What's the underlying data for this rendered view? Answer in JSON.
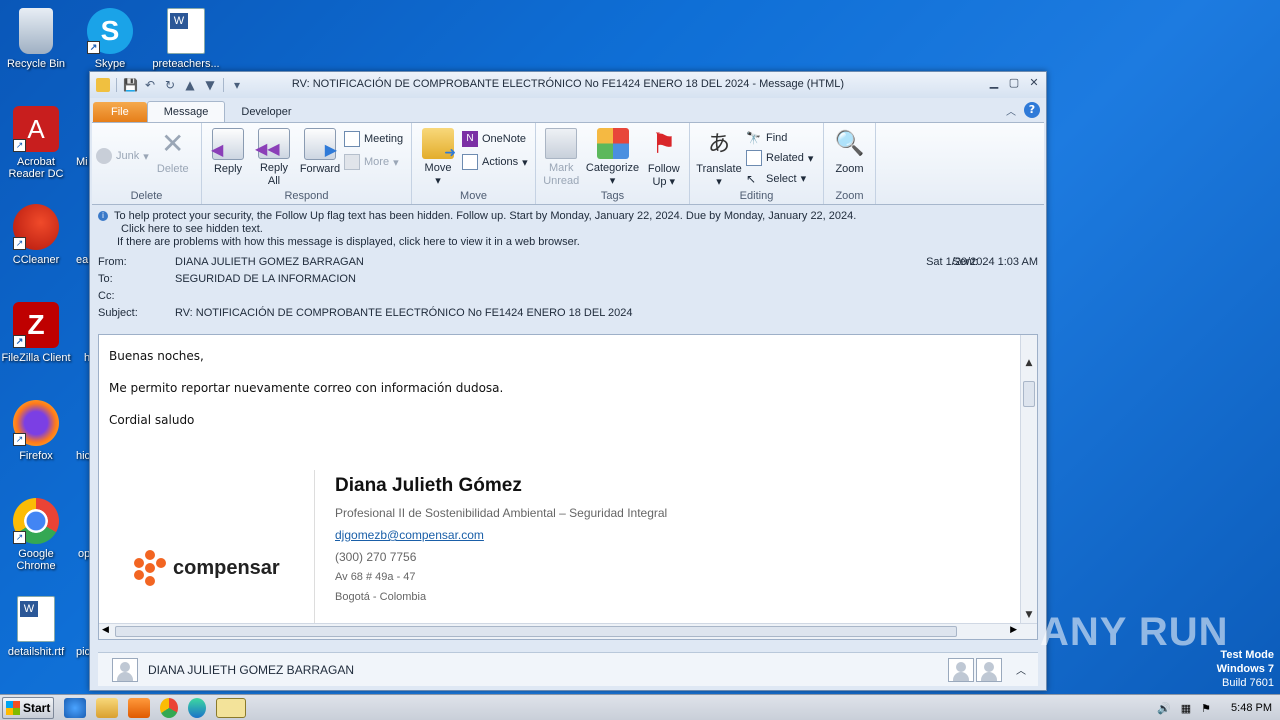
{
  "desktop": {
    "icons": [
      {
        "label": "Recycle Bin"
      },
      {
        "label": "Skype"
      },
      {
        "label": "preteachers..."
      },
      {
        "label": "Acrobat Reader DC"
      },
      {
        "label": "CCleaner"
      },
      {
        "label": "FileZilla Client"
      },
      {
        "label": "Firefox"
      },
      {
        "label": "Google Chrome"
      },
      {
        "label": "detailshit.rtf"
      }
    ],
    "partial_labels": [
      "Mi",
      "ea",
      "h",
      "hic",
      "op",
      "pic"
    ]
  },
  "window": {
    "title": "RV: NOTIFICACIÓN DE COMPROBANTE ELECTRÓNICO No FE1424 ENERO 18 DEL 2024 -  Message (HTML)",
    "tabs": [
      "File",
      "Message",
      "Developer"
    ],
    "active_tab": "Message"
  },
  "ribbon": {
    "delete": {
      "label": "Delete",
      "junk": "Junk",
      "delete_btn": "Delete"
    },
    "respond": {
      "label": "Respond",
      "reply": "Reply",
      "reply_all_1": "Reply",
      "reply_all_2": "All",
      "forward": "Forward",
      "meeting": "Meeting",
      "more": "More"
    },
    "move": {
      "label": "Move",
      "move_btn": "Move",
      "onenote": "OneNote",
      "actions": "Actions"
    },
    "tags": {
      "label": "Tags",
      "mark_unread_1": "Mark",
      "mark_unread_2": "Unread",
      "categorize": "Categorize",
      "follow_up_1": "Follow",
      "follow_up_2": "Up"
    },
    "editing": {
      "label": "Editing",
      "translate": "Translate",
      "find": "Find",
      "related": "Related",
      "select": "Select"
    },
    "zoom": {
      "label": "Zoom",
      "zoom_btn": "Zoom"
    }
  },
  "infobar": {
    "line1": "To help protect your security, the Follow Up flag text has been hidden. Follow up.  Start by Monday, January 22, 2024.  Due by Monday, January 22, 2024.",
    "line2": "Click here to see hidden text.",
    "line3": "If there are problems with how this message is displayed, click here to view it in a web browser."
  },
  "headers": {
    "from_label": "From:",
    "from": "DIANA JULIETH GOMEZ BARRAGAN",
    "sent_label": "Sent:",
    "sent": "Sat 1/20/2024 1:03 AM",
    "to_label": "To:",
    "to": "SEGURIDAD DE LA INFORMACION",
    "cc_label": "Cc:",
    "subject_label": "Subject:",
    "subject": "RV: NOTIFICACIÓN DE COMPROBANTE ELECTRÓNICO No FE1424 ENERO 18 DEL 2024"
  },
  "body": {
    "greeting": "Buenas noches,",
    "paragraph": "Me permito reportar nuevamente correo con información dudosa.",
    "closing": "Cordial saludo"
  },
  "signature": {
    "name": "Diana Julieth Gómez",
    "title": "Profesional II de Sostenibilidad Ambiental – Seguridad Integral",
    "email": "djgomezb@compensar.com",
    "phone": "(300) 270 7756",
    "address": "Av 68 # 49a - 47",
    "city": "Bogotá - Colombia",
    "logo_text": "compensar"
  },
  "people_pane": {
    "name": "DIANA JULIETH GOMEZ BARRAGAN"
  },
  "taskbar": {
    "start": "Start",
    "time": "5:48 PM"
  },
  "watermark": {
    "line1": "Test Mode",
    "line2": "Windows 7",
    "line3": "Build 7601",
    "brand": "ANY RUN"
  },
  "colors": {
    "accent": "#e67e19",
    "link": "#1a5fa8",
    "logo_orange": "#f26522"
  }
}
